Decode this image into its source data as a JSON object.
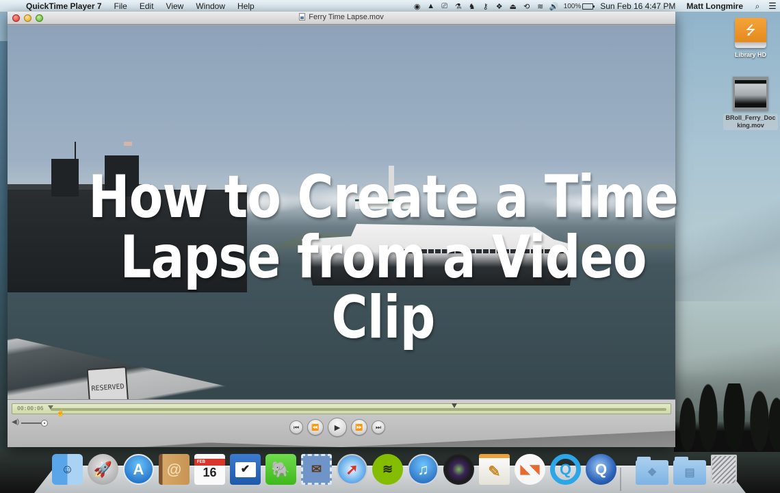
{
  "menubar": {
    "apple_icon": "",
    "app_name": "QuickTime Player 7",
    "menus": [
      "File",
      "Edit",
      "View",
      "Window",
      "Help"
    ],
    "status_icons": [
      {
        "name": "record-icon",
        "glyph": "◉"
      },
      {
        "name": "google-drive-icon",
        "glyph": "▲"
      },
      {
        "name": "screen-share-icon",
        "glyph": "⎚"
      },
      {
        "name": "alfred-icon",
        "glyph": "⚗"
      },
      {
        "name": "evernote-icon",
        "glyph": "♞"
      },
      {
        "name": "key-icon",
        "glyph": "⚷"
      },
      {
        "name": "dropbox-icon",
        "glyph": "❖"
      },
      {
        "name": "airplay-icon",
        "glyph": "⏏"
      },
      {
        "name": "time-machine-icon",
        "glyph": "⟲"
      },
      {
        "name": "wifi-icon",
        "glyph": "≋"
      },
      {
        "name": "volume-icon",
        "glyph": "🔊"
      }
    ],
    "battery": "100%",
    "clock": "Sun Feb 16  4:47 PM",
    "user": "Matt Longmire",
    "spotlight_glyph": "⌕",
    "notifications_glyph": "☰"
  },
  "window": {
    "title": "Ferry Time Lapse.mov",
    "video_overlay_title": [
      "How to Create a Time",
      "Lapse from a Video Clip"
    ],
    "sign_text": "RESERVED",
    "controls": {
      "current_time": "00:00:06",
      "playhead_fraction": 0.0,
      "out_point_fraction": 0.655,
      "volume_fraction": 1.0,
      "buttons": [
        {
          "name": "go-to-start-button",
          "glyph": "⏮"
        },
        {
          "name": "rewind-button",
          "glyph": "⏪"
        },
        {
          "name": "play-button",
          "glyph": "▶"
        },
        {
          "name": "fast-forward-button",
          "glyph": "⏩"
        },
        {
          "name": "go-to-end-button",
          "glyph": "⏭"
        }
      ]
    }
  },
  "desktop": {
    "icons": [
      {
        "label": "Library HD",
        "type": "drive",
        "glyph": "⭍"
      },
      {
        "label": "BRoll_Ferry_Docking.mov",
        "label_lines": [
          "BRoll_Ferry_Doc",
          "king.mov"
        ],
        "type": "movie"
      }
    ]
  },
  "dock": {
    "apps": [
      {
        "name": "finder",
        "glyph": "☺"
      },
      {
        "name": "launchpad",
        "glyph": "🚀"
      },
      {
        "name": "app-store",
        "glyph": "A"
      },
      {
        "name": "contacts",
        "glyph": "@"
      },
      {
        "name": "calendar",
        "month": "FEB",
        "day": "16"
      },
      {
        "name": "reminders",
        "glyph": "✔"
      },
      {
        "name": "evernote",
        "glyph": "🐘"
      },
      {
        "name": "mail",
        "glyph": "✉"
      },
      {
        "name": "safari",
        "glyph": "➚"
      },
      {
        "name": "spotify",
        "glyph": "≋"
      },
      {
        "name": "itunes",
        "glyph": "♫"
      },
      {
        "name": "photo-booth",
        "glyph": "●"
      },
      {
        "name": "pages",
        "glyph": "✎"
      },
      {
        "name": "swift-publisher",
        "glyph": "◣◥"
      },
      {
        "name": "quicktime-player-7",
        "glyph": "Q"
      },
      {
        "name": "quicktime-player",
        "glyph": "Q"
      }
    ],
    "folders": [
      {
        "name": "dropbox-folder",
        "glyph": "❖"
      },
      {
        "name": "documents-folder",
        "glyph": "▤"
      },
      {
        "name": "trash",
        "glyph": ""
      }
    ]
  }
}
